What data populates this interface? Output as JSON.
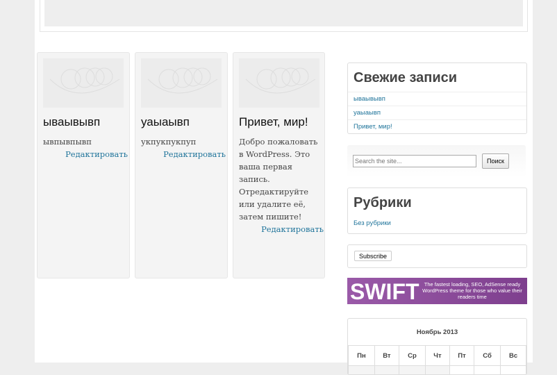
{
  "posts": [
    {
      "title": "ываывывп",
      "excerpt": "ывпывпывп",
      "edit": "Редактировать"
    },
    {
      "title": "уаыаывп",
      "excerpt": "укпукпукпуп",
      "edit": "Редактировать"
    },
    {
      "title": "Привет, мир!",
      "excerpt": "Добро пожаловать в WordPress. Это ваша первая запись. Отредактируйте или удалите её, затем пишите!",
      "edit": "Редактировать"
    }
  ],
  "recent": {
    "title": "Свежие записи",
    "items": [
      "ываывывп",
      "уаыаывп",
      "Привет, мир!"
    ]
  },
  "search": {
    "placeholder": "Search the site...",
    "button": "Поиск"
  },
  "categories": {
    "title": "Рубрики",
    "items": [
      "Без рубрики"
    ]
  },
  "subscribe": {
    "button": "Subscribe"
  },
  "banner": {
    "logo": "SWIFT",
    "tagline": "The fastest loading, SEO, AdSense ready WordPress theme for those who value their readers time"
  },
  "calendar": {
    "caption": "Ноябрь 2013",
    "days": [
      "Пн",
      "Вт",
      "Ср",
      "Чт",
      "Пт",
      "Сб",
      "Вс"
    ]
  }
}
